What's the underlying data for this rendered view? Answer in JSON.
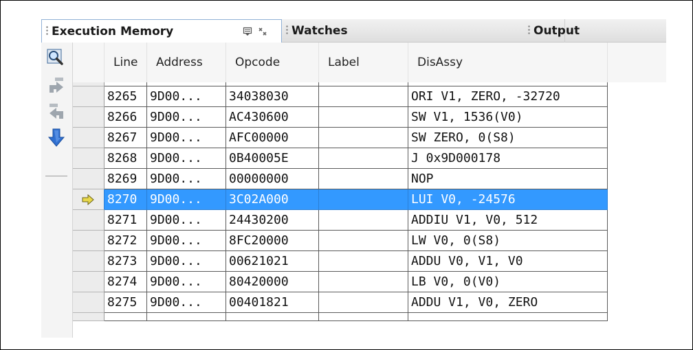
{
  "tabs": [
    {
      "label": "Execution Memory",
      "active": true
    },
    {
      "label": "Watches",
      "active": false
    },
    {
      "label": "Output",
      "active": false
    }
  ],
  "toolbar": {
    "icons": [
      "zoom-icon",
      "step-over-icon",
      "step-back-icon",
      "step-into-icon"
    ]
  },
  "table": {
    "columns": [
      "Line",
      "Address",
      "Opcode",
      "Label",
      "DisAssy"
    ],
    "rows": [
      {
        "line": "8265",
        "address": "9D00...",
        "opcode": "34038030",
        "label": "",
        "disassy": "ORI V1, ZERO, -32720"
      },
      {
        "line": "8266",
        "address": "9D00...",
        "opcode": "AC430600",
        "label": "",
        "disassy": "SW V1, 1536(V0)"
      },
      {
        "line": "8267",
        "address": "9D00...",
        "opcode": "AFC00000",
        "label": "",
        "disassy": "SW ZERO, 0(S8)"
      },
      {
        "line": "8268",
        "address": "9D00...",
        "opcode": "0B40005E",
        "label": "",
        "disassy": "J 0x9D000178"
      },
      {
        "line": "8269",
        "address": "9D00...",
        "opcode": "00000000",
        "label": "",
        "disassy": "NOP"
      },
      {
        "line": "8270",
        "address": "9D00...",
        "opcode": "3C02A000",
        "label": "",
        "disassy": "LUI V0, -24576",
        "current": true
      },
      {
        "line": "8271",
        "address": "9D00...",
        "opcode": "24430200",
        "label": "",
        "disassy": "ADDIU V1, V0, 512"
      },
      {
        "line": "8272",
        "address": "9D00...",
        "opcode": "8FC20000",
        "label": "",
        "disassy": "LW V0, 0(S8)"
      },
      {
        "line": "8273",
        "address": "9D00...",
        "opcode": "00621021",
        "label": "",
        "disassy": "ADDU V0, V1, V0"
      },
      {
        "line": "8274",
        "address": "9D00...",
        "opcode": "80420000",
        "label": "",
        "disassy": "LB V0, 0(V0)"
      },
      {
        "line": "8275",
        "address": "9D00...",
        "opcode": "00401821",
        "label": "",
        "disassy": "ADDU V1, V0, ZERO"
      }
    ]
  },
  "colors": {
    "selection": "#3399ff",
    "pc_arrow": "#e8d84a",
    "tab_border": "#8fb0d6"
  }
}
